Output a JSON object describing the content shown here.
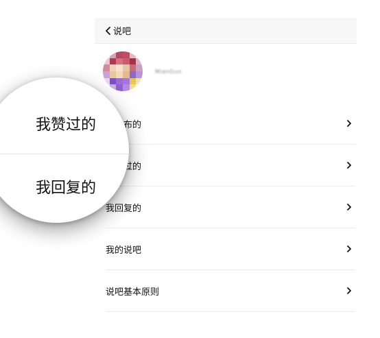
{
  "nav": {
    "back_label": "说吧",
    "back_icon": "chevron-left-icon"
  },
  "profile": {
    "username": "MianGuo"
  },
  "menu": {
    "items": [
      {
        "label": "我发布的"
      },
      {
        "label": "我赞过的"
      },
      {
        "label": "我回复的"
      },
      {
        "label": "我的说吧"
      },
      {
        "label": "说吧基本原则"
      }
    ],
    "chevron_icon": "chevron-right-icon"
  },
  "magnifier": {
    "labels": [
      "我赞过的",
      "我回复的"
    ]
  }
}
